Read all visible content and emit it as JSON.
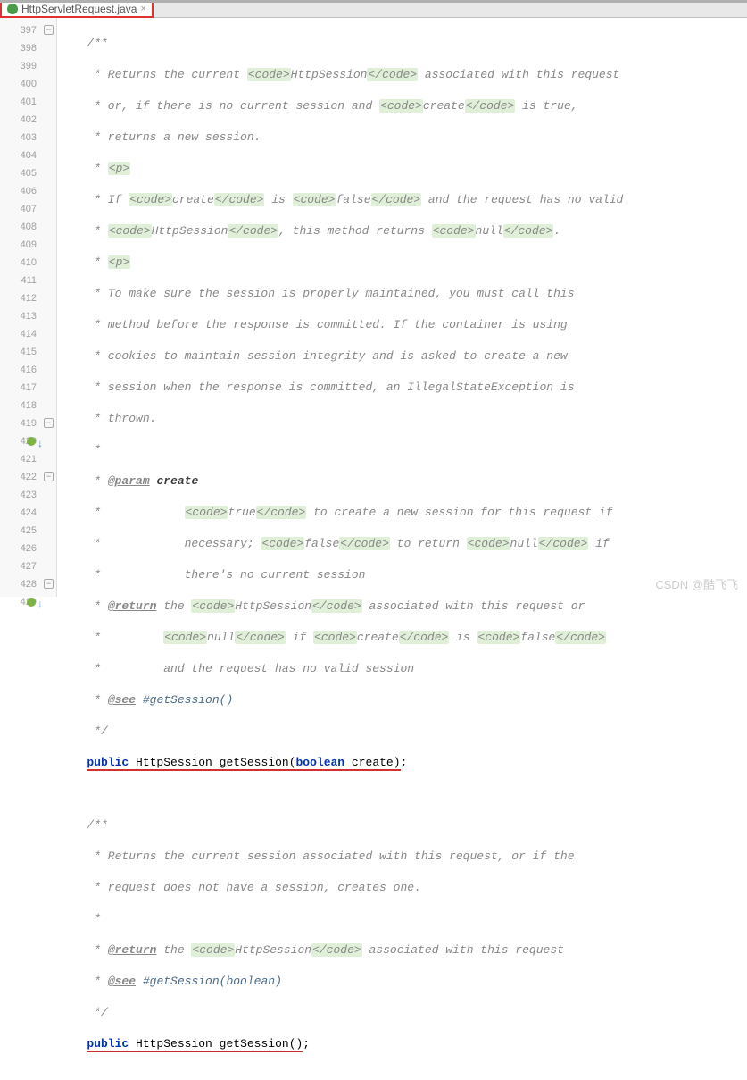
{
  "tab": {
    "filename": "HttpServletRequest.java",
    "close": "×"
  },
  "gutter": {
    "start": 397,
    "lines": [
      397,
      398,
      399,
      400,
      401,
      402,
      403,
      404,
      405,
      406,
      407,
      408,
      409,
      410,
      411,
      412,
      413,
      414,
      415,
      416,
      417,
      418,
      419,
      420,
      421,
      422,
      423,
      424,
      425,
      426,
      427,
      428,
      429
    ]
  },
  "doc1": {
    "l397": "   /**",
    "l398a": "    * Returns the current ",
    "l398b": "<code>",
    "l398c": "HttpSession",
    "l398d": "</code>",
    "l398e": " associated with this request",
    "l399a": "    * or, if there is no current session and ",
    "l399b": "<code>",
    "l399c": "create",
    "l399d": "</code>",
    "l399e": " is true,",
    "l400": "    * returns a new session.",
    "l401a": "    * ",
    "l401b": "<p>",
    "l402a": "    * If ",
    "l402b": "<code>",
    "l402c": "create",
    "l402d": "</code>",
    "l402e": " is ",
    "l402f": "<code>",
    "l402g": "false",
    "l402h": "</code>",
    "l402i": " and the request has no valid",
    "l403a": "    * ",
    "l403b": "<code>",
    "l403c": "HttpSession",
    "l403d": "</code>",
    "l403e": ", this method returns ",
    "l403f": "<code>",
    "l403g": "null",
    "l403h": "</code>",
    "l403i": ".",
    "l404a": "    * ",
    "l404b": "<p>",
    "l405": "    * To make sure the session is properly maintained, you must call this",
    "l406": "    * method before the response is committed. If the container is using",
    "l407": "    * cookies to maintain session integrity and is asked to create a new",
    "l408": "    * session when the response is committed, an IllegalStateException is",
    "l409": "    * thrown.",
    "l410": "    *",
    "l411a": "    * ",
    "l411b": "@param",
    "l411c": " ",
    "l411d": "create",
    "l412a": "    *            ",
    "l412b": "<code>",
    "l412c": "true",
    "l412d": "</code>",
    "l412e": " to create a new session for this request if",
    "l413a": "    *            necessary; ",
    "l413b": "<code>",
    "l413c": "false",
    "l413d": "</code>",
    "l413e": " to return ",
    "l413f": "<code>",
    "l413g": "null",
    "l413h": "</code>",
    "l413i": " if",
    "l414": "    *            there's no current session",
    "l415a": "    * ",
    "l415b": "@return",
    "l415c": " the ",
    "l415d": "<code>",
    "l415e": "HttpSession",
    "l415f": "</code>",
    "l415g": " associated with this request or",
    "l416a": "    *         ",
    "l416b": "<code>",
    "l416c": "null",
    "l416d": "</code>",
    "l416e": " if ",
    "l416f": "<code>",
    "l416g": "create",
    "l416h": "</code>",
    "l416i": " is ",
    "l416j": "<code>",
    "l416k": "false",
    "l416l": "</code>",
    "l417": "    *         and the request has no valid session",
    "l418a": "    * ",
    "l418b": "@see",
    "l418c": " ",
    "l418d": "#getSession()",
    "l419": "    */"
  },
  "sig1": {
    "kw_public": "public",
    "type": "HttpSession",
    "method": "getSession",
    "paren_o": "(",
    "kw_boolean": "boolean",
    "param": " create",
    "paren_c": ")",
    "semi": ";"
  },
  "doc2": {
    "l422": "   /**",
    "l423": "    * Returns the current session associated with this request, or if the",
    "l424": "    * request does not have a session, creates one.",
    "l425": "    *",
    "l426a": "    * ",
    "l426b": "@return",
    "l426c": " the ",
    "l426d": "<code>",
    "l426e": "HttpSession",
    "l426f": "</code>",
    "l426g": " associated with this request",
    "l427a": "    * ",
    "l427b": "@see",
    "l427c": " ",
    "l427d": "#getSession(boolean)",
    "l428": "    */"
  },
  "sig2": {
    "kw_public": "public",
    "type": "HttpSession",
    "method": "getSession",
    "parens": "()",
    "semi": ";"
  },
  "watermark": "CSDN @酷飞飞"
}
